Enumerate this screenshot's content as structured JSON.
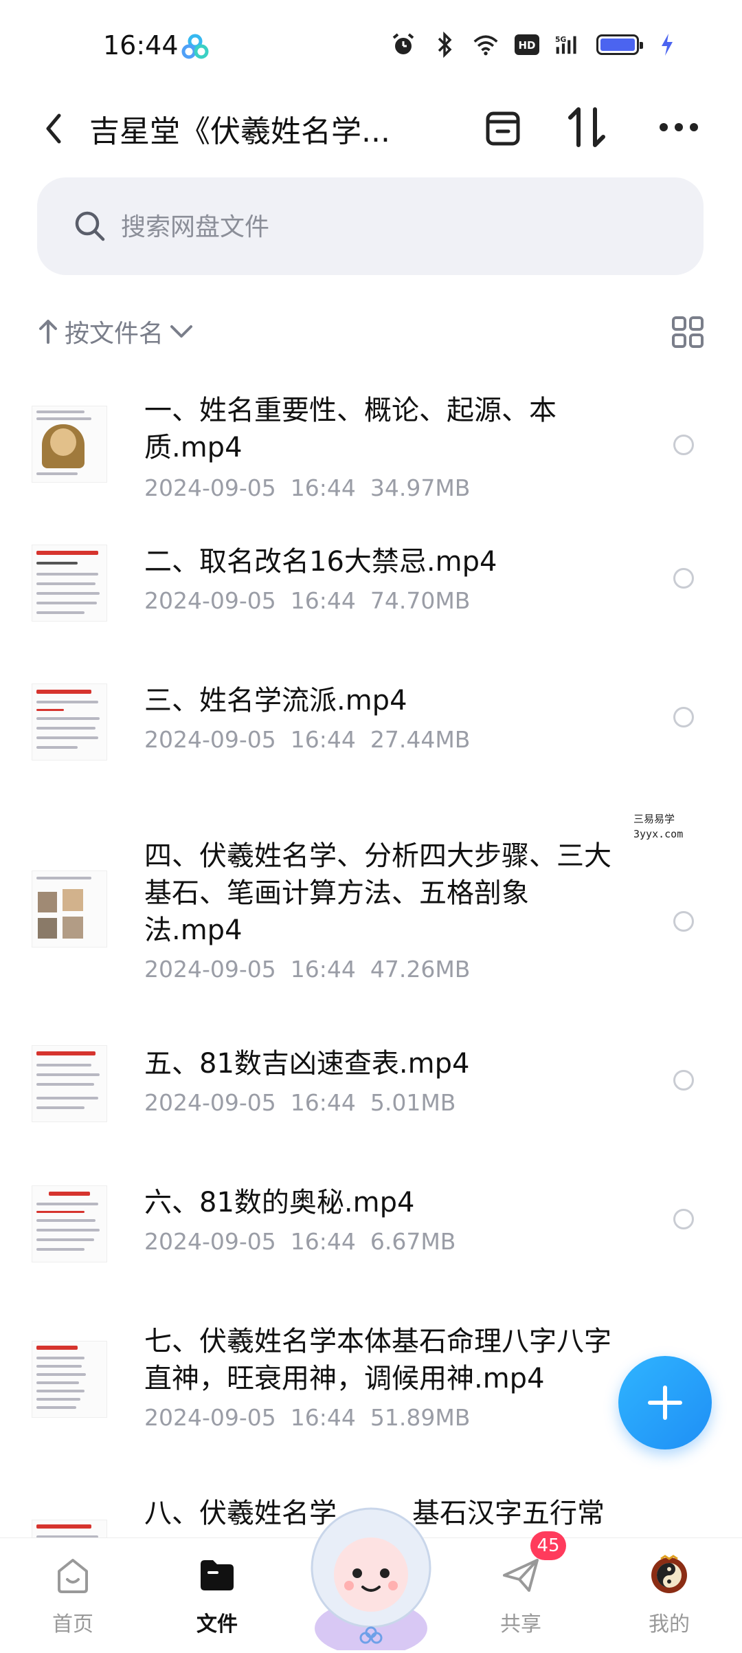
{
  "status_bar": {
    "time": "16:44",
    "network": "5G",
    "hd": "HD"
  },
  "header": {
    "title": "吉星堂《伏羲姓名学..."
  },
  "search": {
    "placeholder": "搜索网盘文件"
  },
  "sort": {
    "label": "按文件名"
  },
  "files": [
    {
      "name": "一、姓名重要性、概论、起源、本质.mp4",
      "date": "2024-09-05",
      "time": "16:44",
      "size": "34.97MB"
    },
    {
      "name": "二、取名改名16大禁忌.mp4",
      "date": "2024-09-05",
      "time": "16:44",
      "size": "74.70MB"
    },
    {
      "name": "三、姓名学流派.mp4",
      "date": "2024-09-05",
      "time": "16:44",
      "size": "27.44MB"
    },
    {
      "name": "四、伏羲姓名学、分析四大步骤、三大基石、笔画计算方法、五格剖象法.mp4",
      "date": "2024-09-05",
      "time": "16:44",
      "size": "47.26MB"
    },
    {
      "name": "五、81数吉凶速查表.mp4",
      "date": "2024-09-05",
      "time": "16:44",
      "size": "5.01MB"
    },
    {
      "name": "六、81数的奥秘.mp4",
      "date": "2024-09-05",
      "time": "16:44",
      "size": "6.67MB"
    },
    {
      "name": "七、伏羲姓名学本体基石命理八字八字直神，旺衰用神，调候用神.mp4",
      "date": "2024-09-05",
      "time": "16:44",
      "size": "51.89MB"
    },
    {
      "name": "八、伏羲姓名学",
      "name_tail": "基石汉字五行常",
      "date": "",
      "time": "",
      "size": ""
    }
  ],
  "watermark": {
    "line1": "三易易学",
    "line2": "3yyx.com"
  },
  "bottom_nav": [
    {
      "label": "首页",
      "active": false
    },
    {
      "label": "文件",
      "active": true
    },
    {
      "label": "共享",
      "active": false,
      "badge": "45"
    },
    {
      "label": "我的",
      "active": false
    }
  ],
  "colors": {
    "accent": "#1f8ff5",
    "badge": "#ff3b5c",
    "meta": "#9a9da6"
  }
}
